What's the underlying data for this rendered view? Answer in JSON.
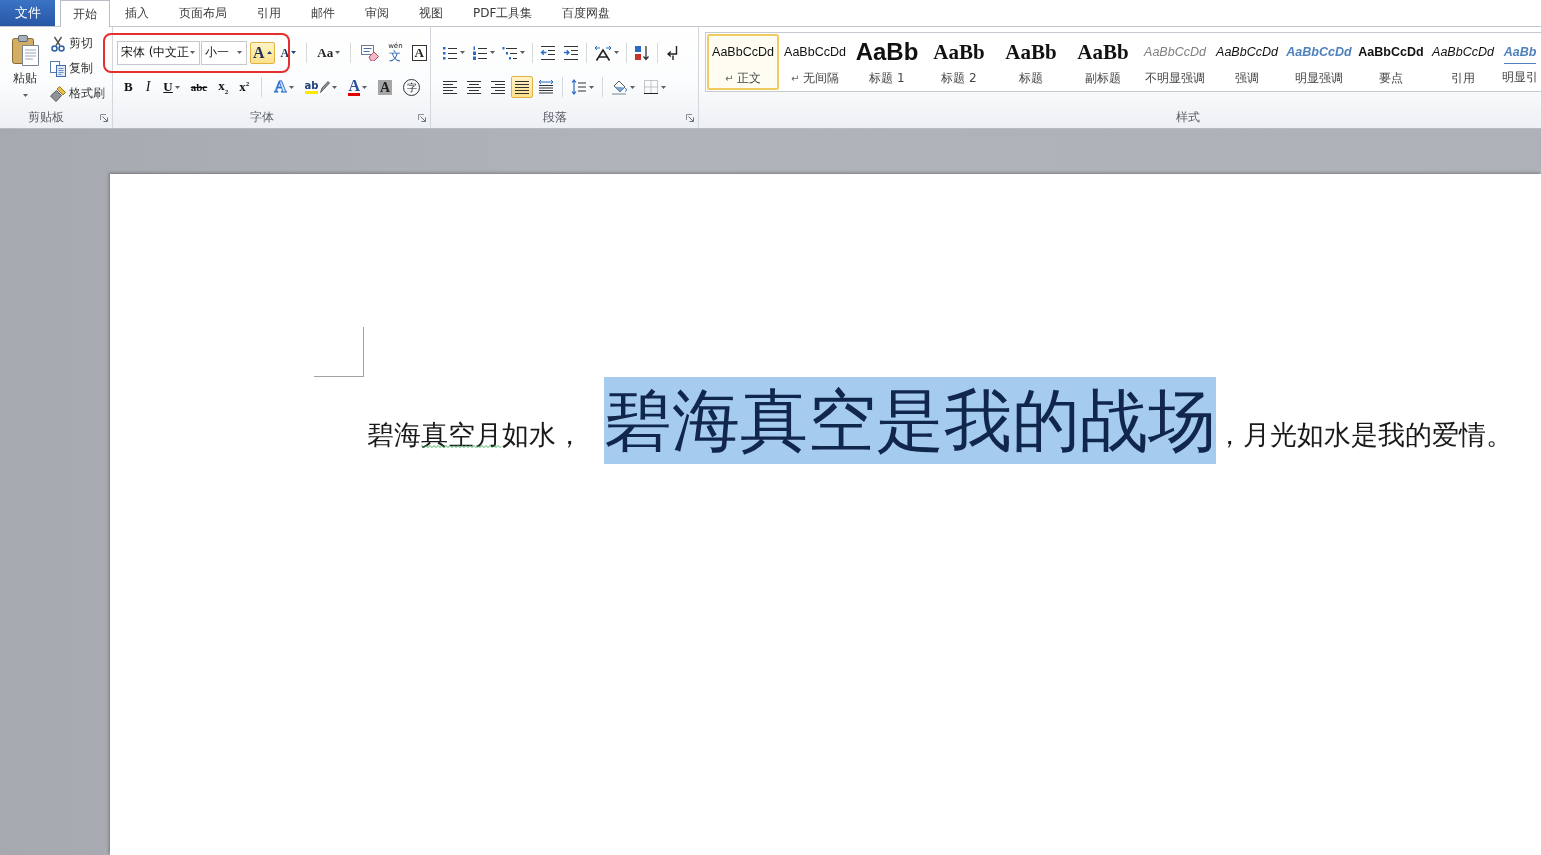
{
  "tabs": [
    {
      "label": "文件",
      "kind": "file",
      "selected": false
    },
    {
      "label": "开始",
      "kind": "tab",
      "selected": true
    },
    {
      "label": "插入",
      "kind": "tab",
      "selected": false
    },
    {
      "label": "页面布局",
      "kind": "tab",
      "selected": false
    },
    {
      "label": "引用",
      "kind": "tab",
      "selected": false
    },
    {
      "label": "邮件",
      "kind": "tab",
      "selected": false
    },
    {
      "label": "审阅",
      "kind": "tab",
      "selected": false
    },
    {
      "label": "视图",
      "kind": "tab",
      "selected": false
    },
    {
      "label": "PDF工具集",
      "kind": "tab",
      "selected": false
    },
    {
      "label": "百度网盘",
      "kind": "tab",
      "selected": false
    }
  ],
  "clipboard": {
    "title": "剪贴板",
    "launcher": true,
    "paste": {
      "label": "粘贴",
      "dropdown": true
    },
    "actions": [
      {
        "kind": "cut",
        "label": "剪切"
      },
      {
        "kind": "copy",
        "label": "复制"
      },
      {
        "kind": "format_painter",
        "label": "格式刷"
      }
    ]
  },
  "font": {
    "title": "字体",
    "launcher": true,
    "font_name": "宋体 (中文正",
    "font_size": "小一",
    "row1": [
      {
        "kind": "grow",
        "label": "A",
        "dropdown": false,
        "active": true
      },
      {
        "kind": "shrink",
        "label": "A",
        "dropdown": false,
        "active": false
      },
      {
        "kind": "change_case",
        "label": "Aa",
        "dropdown": true,
        "active": false
      },
      {
        "kind": "clear_format",
        "dropdown": false,
        "active": false
      },
      {
        "kind": "phonetic",
        "label": "文",
        "ruby": "wén",
        "dropdown": false,
        "active": false
      },
      {
        "kind": "char_border",
        "label": "A",
        "dropdown": false,
        "active": false
      }
    ],
    "row2": [
      {
        "kind": "bold",
        "label": "B",
        "dropdown": false
      },
      {
        "kind": "italic",
        "label": "I",
        "dropdown": false
      },
      {
        "kind": "underline",
        "label": "U",
        "dropdown": true
      },
      {
        "kind": "strike",
        "label": "abc",
        "dropdown": false
      },
      {
        "kind": "subscript",
        "label": "x$_{2}$",
        "dropdown": false
      },
      {
        "kind": "superscript",
        "label": "x$^{2}$",
        "dropdown": false
      },
      {
        "kind": "text_effect",
        "label": "A",
        "dropdown": true
      },
      {
        "kind": "highlight",
        "label": "ab",
        "dropdown": true
      },
      {
        "kind": "font_color",
        "label": "A",
        "dropdown": true
      },
      {
        "kind": "char_shading",
        "label": "A",
        "dropdown": false
      },
      {
        "kind": "enclose",
        "label": "字",
        "dropdown": false
      }
    ]
  },
  "paragraph": {
    "title": "段落",
    "launcher": true,
    "row1": [
      {
        "kind": "bullets",
        "dropdown": true
      },
      {
        "kind": "numbering",
        "dropdown": true
      },
      {
        "kind": "multilevel",
        "dropdown": true
      },
      {
        "kind": "outdent",
        "dropdown": false
      },
      {
        "kind": "indent",
        "dropdown": false
      },
      {
        "kind": "asian_layout",
        "dropdown": true
      },
      {
        "kind": "sort",
        "dropdown": false
      },
      {
        "kind": "show_marks",
        "dropdown": false
      }
    ],
    "alignment": [
      {
        "kind": "left",
        "selected": false
      },
      {
        "kind": "center",
        "selected": false
      },
      {
        "kind": "right",
        "selected": false
      },
      {
        "kind": "justify",
        "selected": true
      },
      {
        "kind": "distributed",
        "selected": false
      }
    ],
    "row2": [
      {
        "kind": "line_spacing",
        "dropdown": true
      },
      {
        "kind": "shading",
        "dropdown": true
      },
      {
        "kind": "borders",
        "dropdown": true
      }
    ]
  },
  "styles": {
    "title": "样式",
    "items": [
      {
        "preview": "AaBbCcDd",
        "mark": "↵",
        "label": "正文",
        "kind": "body",
        "selected": true
      },
      {
        "preview": "AaBbCcDd",
        "mark": "↵",
        "label": "无间隔",
        "kind": "body",
        "selected": false
      },
      {
        "preview": "AaBb",
        "label": "标题 1",
        "kind": "heading1",
        "selected": false
      },
      {
        "preview": "AaBb",
        "label": "标题 2",
        "kind": "heading2",
        "selected": false
      },
      {
        "preview": "AaBb",
        "label": "标题",
        "kind": "title",
        "selected": false
      },
      {
        "preview": "AaBb",
        "label": "副标题",
        "kind": "subtitle",
        "selected": false
      },
      {
        "preview": "AaBbCcDd",
        "label": "不明显强调",
        "kind": "subtle",
        "selected": false
      },
      {
        "preview": "AaBbCcDd",
        "label": "强调",
        "kind": "emphasis",
        "selected": false
      },
      {
        "preview": "AaBbCcDd",
        "label": "明显强调",
        "kind": "intense",
        "selected": false
      },
      {
        "preview": "AaBbCcDd",
        "label": "要点",
        "kind": "strong",
        "selected": false
      },
      {
        "preview": "AaBbCcDd",
        "label": "引用",
        "kind": "quote",
        "selected": false
      },
      {
        "preview": "AaBb",
        "label": "明显引",
        "kind": "intense_quote",
        "selected": false
      }
    ]
  },
  "document": {
    "runs": [
      {
        "kind": "plain",
        "selected": false,
        "segments": [
          {
            "text": "碧海",
            "misspelled": false
          },
          {
            "text": "真空月",
            "misspelled": true
          },
          {
            "text": "如水，",
            "misspelled": false
          }
        ]
      },
      {
        "kind": "enlarged",
        "selected": true,
        "segments": [
          {
            "text": "碧海真空是我的战场",
            "misspelled": false
          }
        ]
      },
      {
        "kind": "plain",
        "selected": false,
        "segments": [
          {
            "text": "，月光如水是我的爱情。",
            "misspelled": false
          }
        ]
      }
    ]
  }
}
